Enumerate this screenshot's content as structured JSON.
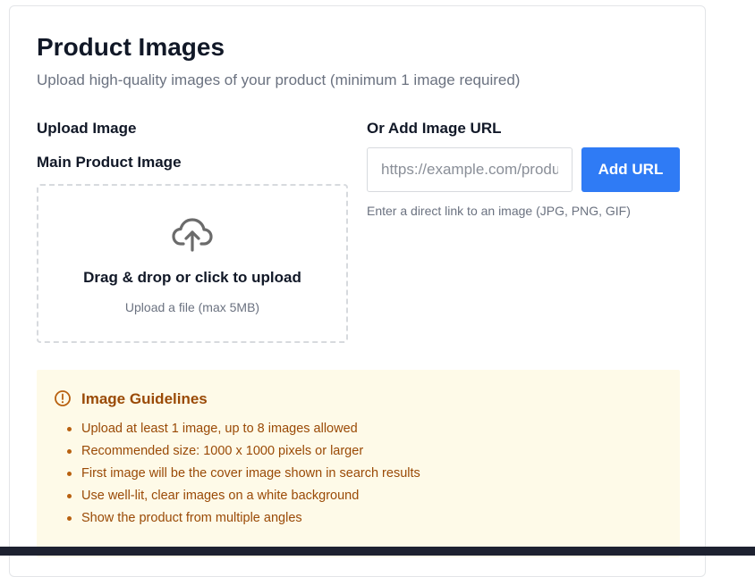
{
  "section": {
    "title": "Product Images",
    "subtitle": "Upload high-quality images of your product (minimum 1 image required)"
  },
  "upload": {
    "label": "Upload Image",
    "main_label": "Main Product Image",
    "dropzone_title": "Drag & drop or click to upload",
    "dropzone_sub": "Upload a file (max 5MB)",
    "icon": "cloud-upload-icon"
  },
  "url": {
    "label": "Or Add Image URL",
    "placeholder": "https://example.com/product-image.jpg",
    "value": "",
    "button_label": "Add URL",
    "hint": "Enter a direct link to an image (JPG, PNG, GIF)"
  },
  "guidelines": {
    "title": "Image Guidelines",
    "icon": "alert-circle-icon",
    "items": [
      "Upload at least 1 image, up to 8 images allowed",
      "Recommended size: 1000 x 1000 pixels or larger",
      "First image will be the cover image shown in search results",
      "Use well-lit, clear images on a white background",
      "Show the product from multiple angles"
    ]
  },
  "colors": {
    "accent": "#2f7bf5",
    "guideline_bg": "#fefae8",
    "guideline_text": "#9a4a06"
  }
}
